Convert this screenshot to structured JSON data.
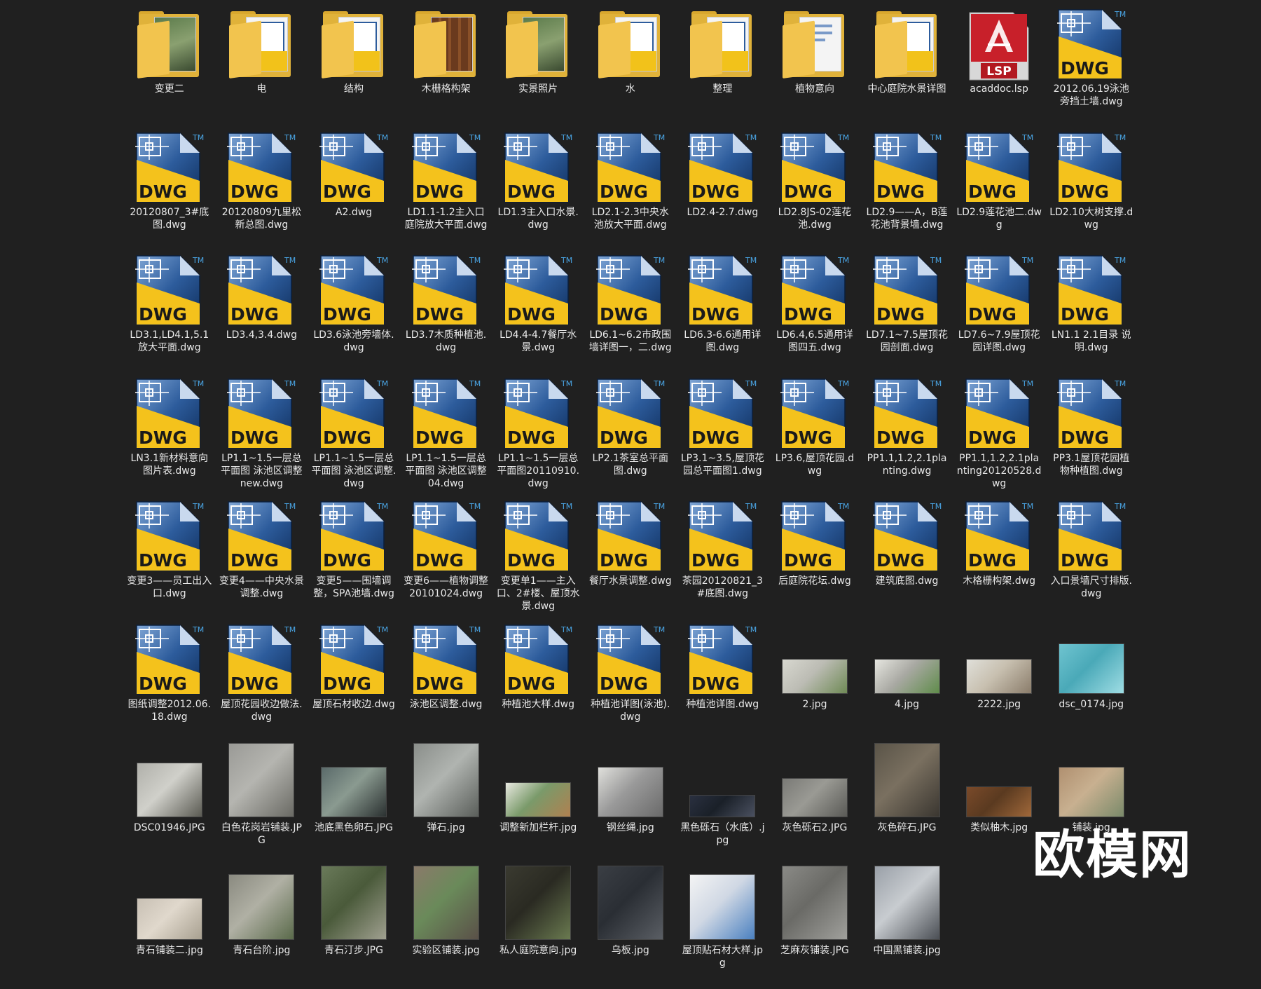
{
  "items": [
    {
      "kind": "folder",
      "label": "变更二",
      "variant": "photo"
    },
    {
      "kind": "folder",
      "label": "电",
      "variant": "dwg"
    },
    {
      "kind": "folder",
      "label": "结构",
      "variant": "dwg"
    },
    {
      "kind": "folder",
      "label": "木栅格构架",
      "variant": "wood"
    },
    {
      "kind": "folder",
      "label": "实景照片",
      "variant": "photo"
    },
    {
      "kind": "folder",
      "label": "水",
      "variant": "dwg"
    },
    {
      "kind": "folder",
      "label": "整理",
      "variant": "dwg"
    },
    {
      "kind": "folder",
      "label": "植物意向",
      "variant": "doc"
    },
    {
      "kind": "folder",
      "label": "中心庭院水景详图",
      "variant": "dwg"
    },
    {
      "kind": "lsp",
      "label": "acaddoc.lsp"
    },
    {
      "kind": "dwg",
      "label": "2012.06.19泳池旁挡土墙.dwg"
    },
    {
      "kind": "dwg",
      "label": "20120807_3#底图.dwg"
    },
    {
      "kind": "dwg",
      "label": "20120809九里松新总图.dwg"
    },
    {
      "kind": "dwg",
      "label": "A2.dwg"
    },
    {
      "kind": "dwg",
      "label": "LD1.1-1.2主入口庭院放大平面.dwg"
    },
    {
      "kind": "dwg",
      "label": "LD1.3主入口水景.dwg"
    },
    {
      "kind": "dwg",
      "label": "LD2.1-2.3中央水池放大平面.dwg"
    },
    {
      "kind": "dwg",
      "label": "LD2.4-2.7.dwg"
    },
    {
      "kind": "dwg",
      "label": "LD2.8JS-02莲花池.dwg"
    },
    {
      "kind": "dwg",
      "label": "LD2.9——A，B莲花池背景墙.dwg"
    },
    {
      "kind": "dwg",
      "label": "LD2.9莲花池二.dwg"
    },
    {
      "kind": "dwg",
      "label": "LD2.10大树支撑.dwg"
    },
    {
      "kind": "dwg",
      "label": "LD3.1,LD4.1,5.1放大平面.dwg"
    },
    {
      "kind": "dwg",
      "label": "LD3.4,3.4.dwg"
    },
    {
      "kind": "dwg",
      "label": "LD3.6泳池旁墙体.dwg"
    },
    {
      "kind": "dwg",
      "label": "LD3.7木质种植池.dwg"
    },
    {
      "kind": "dwg",
      "label": "LD4.4-4.7餐厅水景.dwg"
    },
    {
      "kind": "dwg",
      "label": "LD6.1~6.2市政围墙详图一，二.dwg"
    },
    {
      "kind": "dwg",
      "label": "LD6.3-6.6通用详图.dwg"
    },
    {
      "kind": "dwg",
      "label": "LD6.4,6.5通用详图四五.dwg"
    },
    {
      "kind": "dwg",
      "label": "LD7.1~7.5屋顶花园剖面.dwg"
    },
    {
      "kind": "dwg",
      "label": "LD7.6~7.9屋顶花园详图.dwg"
    },
    {
      "kind": "dwg",
      "label": "LN1.1 2.1目录 说明.dwg"
    },
    {
      "kind": "dwg",
      "label": "LN3.1新材料意向图片表.dwg"
    },
    {
      "kind": "dwg",
      "label": "LP1.1~1.5一层总平面图 泳池区调整 new.dwg"
    },
    {
      "kind": "dwg",
      "label": "LP1.1~1.5一层总平面图 泳池区调整.dwg"
    },
    {
      "kind": "dwg",
      "label": "LP1.1~1.5一层总平面图 泳池区调整04.dwg"
    },
    {
      "kind": "dwg",
      "label": "LP1.1~1.5一层总平面图20110910.dwg"
    },
    {
      "kind": "dwg",
      "label": "LP2.1茶室总平面图.dwg"
    },
    {
      "kind": "dwg",
      "label": "LP3.1~3.5,屋顶花园总平面图1.dwg"
    },
    {
      "kind": "dwg",
      "label": "LP3.6,屋顶花园.dwg"
    },
    {
      "kind": "dwg",
      "label": "PP1.1,1.2,2.1planting.dwg"
    },
    {
      "kind": "dwg",
      "label": "PP1.1,1.2,2.1planting20120528.dwg"
    },
    {
      "kind": "dwg",
      "label": "PP3.1屋顶花园植物种植图.dwg"
    },
    {
      "kind": "dwg",
      "label": "变更3——员工出入口.dwg"
    },
    {
      "kind": "dwg",
      "label": "变更4——中央水景调整.dwg"
    },
    {
      "kind": "dwg",
      "label": "变更5——围墙调整，SPA池墙.dwg"
    },
    {
      "kind": "dwg",
      "label": "变更6——植物调整20101024.dwg"
    },
    {
      "kind": "dwg",
      "label": "变更单1——主入口、2#楼、屋顶水景.dwg"
    },
    {
      "kind": "dwg",
      "label": "餐厅水景调整.dwg"
    },
    {
      "kind": "dwg",
      "label": "茶园20120821_3#底图.dwg"
    },
    {
      "kind": "dwg",
      "label": "后庭院花坛.dwg"
    },
    {
      "kind": "dwg",
      "label": "建筑底图.dwg"
    },
    {
      "kind": "dwg",
      "label": "木格栅构架.dwg"
    },
    {
      "kind": "dwg",
      "label": "入口景墙尺寸排版.dwg"
    },
    {
      "kind": "dwg",
      "label": "图纸调整2012.06.18.dwg"
    },
    {
      "kind": "dwg",
      "label": "屋顶花园收边做法.dwg"
    },
    {
      "kind": "dwg",
      "label": "屋顶石材收边.dwg"
    },
    {
      "kind": "dwg",
      "label": "泳池区调整.dwg"
    },
    {
      "kind": "dwg",
      "label": "种植池大样.dwg"
    },
    {
      "kind": "dwg",
      "label": "种植池详图(泳池).dwg"
    },
    {
      "kind": "dwg",
      "label": "种植池详图.dwg"
    },
    {
      "kind": "photo",
      "label": "2.jpg",
      "colors": [
        "#d8d8d0",
        "#6f8a55",
        "#bcbcb4"
      ],
      "h": 48
    },
    {
      "kind": "photo",
      "label": "4.jpg",
      "colors": [
        "#e6e6e0",
        "#5f8c4a",
        "#a9a9a3"
      ],
      "h": 48
    },
    {
      "kind": "photo",
      "label": "2222.jpg",
      "colors": [
        "#e0e0da",
        "#8a7c6a",
        "#c8c0b0"
      ],
      "h": 48
    },
    {
      "kind": "photo",
      "label": "dsc_0174.jpg",
      "colors": [
        "#6fc4d0",
        "#9fdde4",
        "#4aa9b8"
      ],
      "h": 70
    },
    {
      "kind": "photo",
      "label": "DSC01946.JPG",
      "colors": [
        "#b0b0aa",
        "#5a5a52",
        "#d0d0ca"
      ],
      "h": 76
    },
    {
      "kind": "photo",
      "label": "白色花岗岩铺装.JPG",
      "colors": [
        "#9a9a96",
        "#6a6a64",
        "#b5b5b0"
      ],
      "h": 104
    },
    {
      "kind": "photo",
      "label": "池底黑色卵石.JPG",
      "colors": [
        "#5a6a6a",
        "#2a3030",
        "#8a9a90"
      ],
      "h": 70
    },
    {
      "kind": "photo",
      "label": "弹石.jpg",
      "colors": [
        "#8a8e8a",
        "#5a5e5a",
        "#b0b4b0"
      ],
      "h": 104
    },
    {
      "kind": "photo",
      "label": "调整新加栏杆.jpg",
      "colors": [
        "#e8e8e0",
        "#b08050",
        "#7a9a6a"
      ],
      "h": 48
    },
    {
      "kind": "photo",
      "label": "钢丝绳.jpg",
      "colors": [
        "#e0e0dc",
        "#6a6a6a",
        "#9a9a9a"
      ],
      "h": 70
    },
    {
      "kind": "photo",
      "label": "黑色砾石（水底）.jpg",
      "colors": [
        "#2a3040",
        "#4a5060",
        "#1a2028"
      ],
      "h": 30
    },
    {
      "kind": "photo",
      "label": "灰色砾石2.JPG",
      "colors": [
        "#7a7a76",
        "#5a5a56",
        "#9a9a94"
      ],
      "h": 54
    },
    {
      "kind": "photo",
      "label": "灰色碎石.JPG",
      "colors": [
        "#5a5448",
        "#3a3630",
        "#7a7060"
      ],
      "h": 104
    },
    {
      "kind": "photo",
      "label": "类似柚木.jpg",
      "colors": [
        "#7a4a2a",
        "#a0683a",
        "#5a3a20"
      ],
      "h": 42
    },
    {
      "kind": "photo",
      "label": "铺装.jpg",
      "colors": [
        "#b09070",
        "#7a8a6a",
        "#c8b090"
      ],
      "h": 70
    },
    {
      "kind": "photo",
      "label": "青石铺装二.jpg",
      "colors": [
        "#c8c0b4",
        "#a8a090",
        "#e0d8cc"
      ],
      "h": 58
    },
    {
      "kind": "photo",
      "label": "青石台阶.jpg",
      "colors": [
        "#8a8a80",
        "#5a6a4a",
        "#b0b0a4"
      ],
      "h": 92
    },
    {
      "kind": "photo",
      "label": "青石汀步.JPG",
      "colors": [
        "#6a7a5a",
        "#a0a090",
        "#4a5a3a"
      ],
      "h": 104
    },
    {
      "kind": "photo",
      "label": "实验区铺装.jpg",
      "colors": [
        "#8a7a6a",
        "#5a5048",
        "#6a8a5a"
      ],
      "h": 104
    },
    {
      "kind": "photo",
      "label": "私人庭院意向.jpg",
      "colors": [
        "#3a3a30",
        "#6a7a50",
        "#2a2a22"
      ],
      "h": 104
    },
    {
      "kind": "photo",
      "label": "乌板.jpg",
      "colors": [
        "#3a3e44",
        "#5a5e64",
        "#2a2e34"
      ],
      "h": 104
    },
    {
      "kind": "photo",
      "label": "屋顶贴石材大样.jpg",
      "colors": [
        "#f4f4f4",
        "#4a80c0",
        "#d0d8e4"
      ],
      "h": 92
    },
    {
      "kind": "photo",
      "label": "芝麻灰铺装.JPG",
      "colors": [
        "#8a8a86",
        "#a0a09c",
        "#6a6a66"
      ],
      "h": 104
    },
    {
      "kind": "photo",
      "label": "中国黑铺装.jpg",
      "colors": [
        "#9aa0a8",
        "#4a4e54",
        "#c8ccd0"
      ],
      "h": 104
    }
  ],
  "watermark": "欧模网",
  "colors": {
    "background": "#202020",
    "label": "#e8e8e8",
    "dwg_yellow": "#f2c21a",
    "dwg_blue": "#1e4a86"
  },
  "icons": {
    "folder": "folder-icon",
    "dwg": "dwg-file-icon",
    "lsp": "lsp-file-icon",
    "photo": "image-thumbnail"
  }
}
